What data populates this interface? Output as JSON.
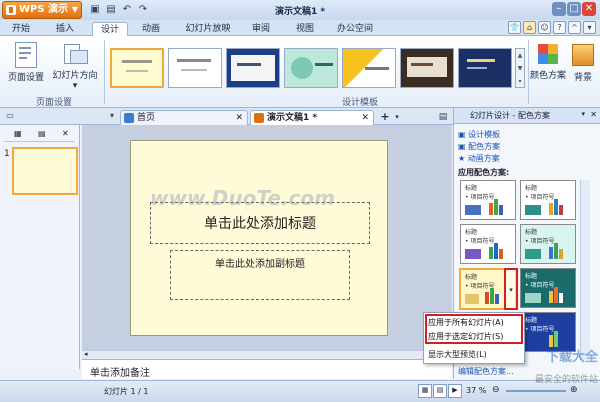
{
  "app": {
    "name": "WPS 演示",
    "document_title": "演示文稿1 *"
  },
  "tabs": [
    "开始",
    "插入",
    "设计",
    "动画",
    "幻灯片放映",
    "审阅",
    "视图",
    "办公空间"
  ],
  "ribbon": {
    "page_setup": "页面设置",
    "slide_orientation": "幻灯片方向",
    "group_page_setup": "页面设置",
    "group_design_template": "设计模板",
    "color_scheme": "颜色方案",
    "background": "背景"
  },
  "doc_tabs": {
    "home": "首页",
    "doc": "演示文稿1 *"
  },
  "slide": {
    "title_placeholder": "单击此处添加标题",
    "subtitle_placeholder": "单击此处添加副标题",
    "slide_number": "1"
  },
  "notes_placeholder": "单击添加备注",
  "right_pane": {
    "header": "幻灯片设计 - 配色方案",
    "links": [
      "设计模板",
      "配色方案",
      "动画方案"
    ],
    "apply_label": "应用配色方案:",
    "swatch_title": "标题",
    "swatch_item": "• 项目符号",
    "edit_link": "编辑配色方案..."
  },
  "context_menu": [
    "应用于所有幻灯片(A)",
    "应用于选定幻灯片(S)",
    "显示大型预览(L)"
  ],
  "status": {
    "slide_info": "幻灯片 1 / 1",
    "zoom": "37 %"
  },
  "watermark": {
    "center": "www.DuoTe.com",
    "corner_big": "下载大全",
    "corner_small": "最安全的软件站"
  },
  "colors": {
    "accent_orange": "#e0700e",
    "tab_blue": "#d5e3f5",
    "highlight_red": "#d21f1f",
    "slide_bg": "#fffbd8"
  }
}
